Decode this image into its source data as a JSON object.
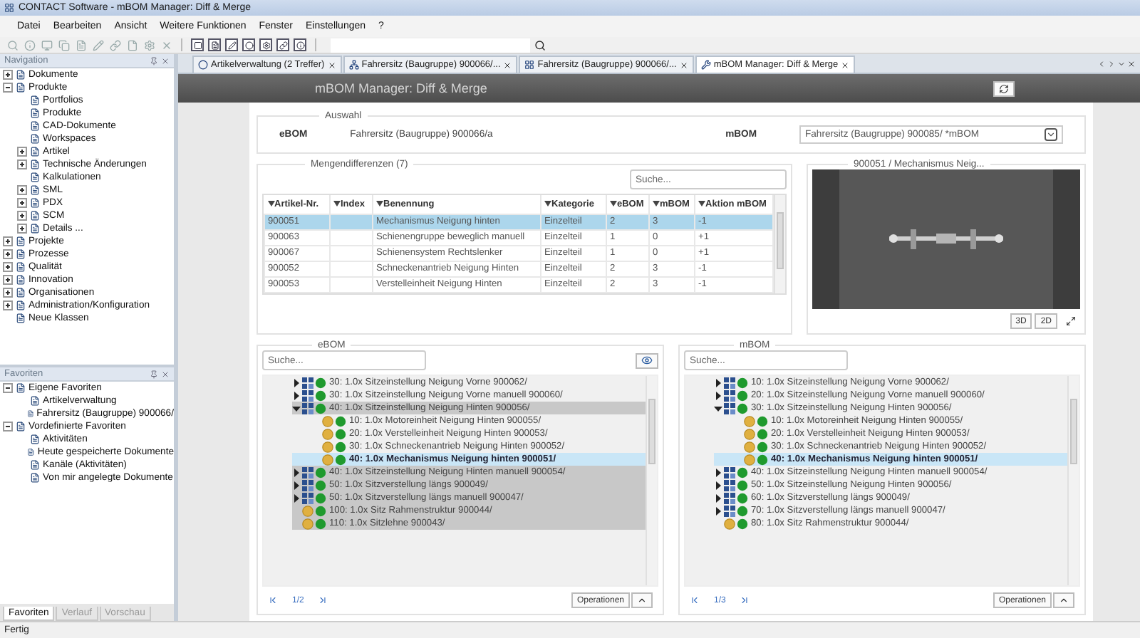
{
  "window": {
    "title": "CONTACT Software - mBOM Manager: Diff & Merge"
  },
  "menu": [
    "Datei",
    "Bearbeiten",
    "Ansicht",
    "Weitere Funktionen",
    "Fenster",
    "Einstellungen",
    "?"
  ],
  "navigation": {
    "title": "Navigation",
    "items": [
      {
        "label": "Dokumente",
        "expanded": false
      },
      {
        "label": "Produkte",
        "expanded": true,
        "children": [
          {
            "label": "Portfolios"
          },
          {
            "label": "Produkte"
          },
          {
            "label": "CAD-Dokumente"
          },
          {
            "label": "Workspaces"
          },
          {
            "label": "Artikel",
            "expanded": false
          },
          {
            "label": "Technische Änderungen",
            "expanded": false
          },
          {
            "label": "Kalkulationen"
          },
          {
            "label": "SML",
            "expanded": false
          },
          {
            "label": "PDX",
            "expanded": false
          },
          {
            "label": "SCM",
            "expanded": false
          },
          {
            "label": "Details ...",
            "expanded": false
          }
        ]
      },
      {
        "label": "Projekte",
        "expanded": false
      },
      {
        "label": "Prozesse",
        "expanded": false
      },
      {
        "label": "Qualität",
        "expanded": false
      },
      {
        "label": "Innovation",
        "expanded": false
      },
      {
        "label": "Organisationen",
        "expanded": false
      },
      {
        "label": "Administration/Konfiguration",
        "expanded": false
      },
      {
        "label": "Neue Klassen"
      }
    ]
  },
  "favorites": {
    "title": "Favoriten",
    "items": [
      {
        "label": "Eigene Favoriten",
        "expanded": true,
        "children": [
          {
            "label": "Artikelverwaltung"
          },
          {
            "label": "Fahrersitz (Baugruppe) 900066/"
          }
        ]
      },
      {
        "label": "Vordefinierte Favoriten",
        "expanded": true,
        "children": [
          {
            "label": "Aktivitäten"
          },
          {
            "label": "Heute gespeicherte Dokumente"
          },
          {
            "label": "Kanäle (Aktivitäten)"
          },
          {
            "label": "Von mir angelegte Dokumente"
          }
        ]
      }
    ]
  },
  "sidebar_tabs": [
    {
      "label": "Favoriten",
      "selected": true
    },
    {
      "label": "Verlauf",
      "selected": false
    },
    {
      "label": "Vorschau",
      "selected": false
    }
  ],
  "tabs": [
    {
      "label": "Artikelverwaltung (2 Treffer)",
      "selected": false
    },
    {
      "label": "Fahrersitz (Baugruppe) 900066/...",
      "selected": false
    },
    {
      "label": "Fahrersitz (Baugruppe) 900066/...",
      "selected": false
    },
    {
      "label": "mBOM Manager: Diff & Merge",
      "selected": true
    }
  ],
  "header": {
    "title": "mBOM Manager: Diff & Merge"
  },
  "selection": {
    "legend": "Auswahl",
    "ebom_label": "eBOM",
    "ebom_value": "Fahrersitz (Baugruppe) 900066/a",
    "mbom_label": "mBOM",
    "mbom_value": "Fahrersitz (Baugruppe) 900085/ *mBOM"
  },
  "differences": {
    "legend": "Mengendifferenzen (7)",
    "search_placeholder": "Suche...",
    "columns": [
      "Artikel-Nr.",
      "Index",
      "Benennung",
      "Kategorie",
      "eBOM",
      "mBOM",
      "Aktion mBOM"
    ],
    "rows": [
      {
        "cells": [
          "900051",
          "",
          "Mechanismus Neigung hinten",
          "Einzelteil",
          "2",
          "3",
          "-1"
        ],
        "selected": true
      },
      {
        "cells": [
          "900063",
          "",
          "Schienengruppe beweglich manuell",
          "Einzelteil",
          "1",
          "0",
          "+1"
        ],
        "selected": false
      },
      {
        "cells": [
          "900067",
          "",
          "Schienensystem Rechtslenker",
          "Einzelteil",
          "1",
          "0",
          "+1"
        ],
        "selected": false
      },
      {
        "cells": [
          "900052",
          "",
          "Schneckenantrieb Neigung Hinten",
          "Einzelteil",
          "2",
          "3",
          "-1"
        ],
        "selected": false
      },
      {
        "cells": [
          "900053",
          "",
          "Verstelleinheit Neigung Hinten",
          "Einzelteil",
          "2",
          "3",
          "-1"
        ],
        "selected": false
      }
    ]
  },
  "preview": {
    "legend": "900051 / Mechanismus Neig...",
    "buttons": [
      "3D",
      "2D"
    ]
  },
  "ebom": {
    "legend": "eBOM",
    "search_placeholder": "Suche...",
    "page": "1/2",
    "operations": "Operationen",
    "items": [
      {
        "label": "30: 1.0x Sitzeinstellung Neigung Vorne 900062/",
        "kind": "group",
        "expanded": false,
        "highlighted": false,
        "selected": false
      },
      {
        "label": "30: 1.0x Sitzeinstellung Neigung Vorne manuell 900060/",
        "kind": "group",
        "expanded": false,
        "highlighted": false,
        "selected": false
      },
      {
        "label": "40: 1.0x Sitzeinstellung Neigung Hinten 900056/",
        "kind": "group",
        "expanded": true,
        "highlighted": true,
        "selected": false,
        "children": [
          {
            "label": "10: 1.0x Motoreinheit Neigung Hinten 900055/",
            "kind": "part",
            "highlighted": false,
            "selected": false
          },
          {
            "label": "20: 1.0x Verstelleinheit Neigung Hinten 900053/",
            "kind": "part",
            "highlighted": false,
            "selected": false
          },
          {
            "label": "30: 1.0x Schneckenantrieb Neigung Hinten 900052/",
            "kind": "part",
            "highlighted": false,
            "selected": false
          },
          {
            "label": "40: 1.0x Mechanismus Neigung hinten 900051/",
            "kind": "part",
            "highlighted": false,
            "selected": true
          }
        ]
      },
      {
        "label": "40: 1.0x Sitzeinstellung Neigung Hinten manuell 900054/",
        "kind": "group",
        "expanded": false,
        "highlighted": true,
        "selected": false
      },
      {
        "label": "50: 1.0x Sitzverstellung längs 900049/",
        "kind": "group",
        "expanded": false,
        "highlighted": true,
        "selected": false
      },
      {
        "label": "50: 1.0x Sitzverstellung längs manuell 900047/",
        "kind": "group",
        "expanded": false,
        "highlighted": true,
        "selected": false
      },
      {
        "label": "100: 1.0x Sitz Rahmenstruktur 900044/",
        "kind": "part",
        "highlighted": true,
        "selected": false
      },
      {
        "label": "110: 1.0x Sitzlehne 900043/",
        "kind": "part",
        "highlighted": true,
        "selected": false
      }
    ]
  },
  "mbom": {
    "legend": "mBOM",
    "search_placeholder": "Suche...",
    "page": "1/3",
    "operations": "Operationen",
    "items": [
      {
        "label": "10: 1.0x Sitzeinstellung Neigung Vorne 900062/",
        "kind": "group",
        "expanded": false,
        "highlighted": false,
        "selected": false
      },
      {
        "label": "20: 1.0x Sitzeinstellung Neigung Vorne manuell 900060/",
        "kind": "group",
        "expanded": false,
        "highlighted": false,
        "selected": false
      },
      {
        "label": "30: 1.0x Sitzeinstellung Neigung Hinten 900056/",
        "kind": "group",
        "expanded": true,
        "highlighted": false,
        "selected": false,
        "children": [
          {
            "label": "10: 1.0x Motoreinheit Neigung Hinten 900055/",
            "kind": "part",
            "highlighted": false,
            "selected": false
          },
          {
            "label": "20: 1.0x Verstelleinheit Neigung Hinten 900053/",
            "kind": "part",
            "highlighted": false,
            "selected": false
          },
          {
            "label": "30: 1.0x Schneckenantrieb Neigung Hinten 900052/",
            "kind": "part",
            "highlighted": false,
            "selected": false
          },
          {
            "label": "40: 1.0x Mechanismus Neigung hinten 900051/",
            "kind": "part",
            "highlighted": false,
            "selected": true
          }
        ]
      },
      {
        "label": "40: 1.0x Sitzeinstellung Neigung Hinten manuell 900054/",
        "kind": "group",
        "expanded": false,
        "highlighted": false,
        "selected": false
      },
      {
        "label": "50: 1.0x Sitzeinstellung Neigung Hinten 900056/",
        "kind": "group",
        "expanded": false,
        "highlighted": false,
        "selected": false
      },
      {
        "label": "60: 1.0x Sitzverstellung längs 900049/",
        "kind": "group",
        "expanded": false,
        "highlighted": false,
        "selected": false
      },
      {
        "label": "70: 1.0x Sitzverstellung längs manuell 900047/",
        "kind": "group",
        "expanded": false,
        "highlighted": false,
        "selected": false
      },
      {
        "label": "80: 1.0x Sitz Rahmenstruktur 900044/",
        "kind": "part",
        "highlighted": false,
        "selected": false
      }
    ]
  },
  "status_bar": "Fertig"
}
